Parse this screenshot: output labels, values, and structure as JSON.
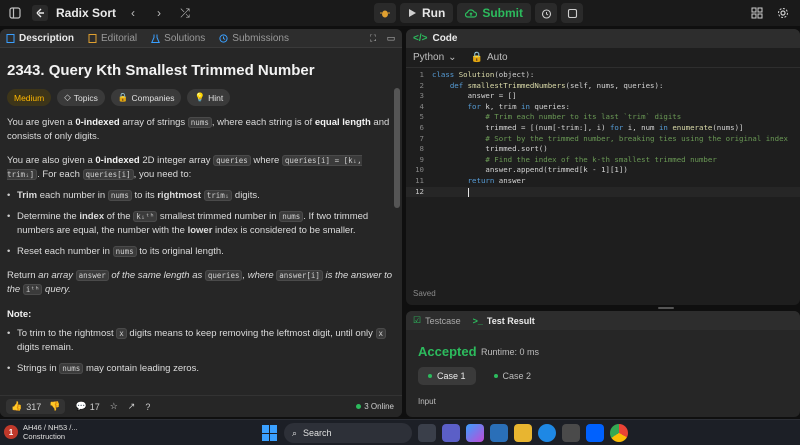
{
  "topbar": {
    "title": "Radix Sort",
    "run_label": "Run",
    "submit_label": "Submit"
  },
  "left": {
    "tabs": [
      {
        "label": "Description"
      },
      {
        "label": "Editorial"
      },
      {
        "label": "Solutions"
      },
      {
        "label": "Submissions"
      }
    ],
    "problem_title": "2343. Query Kth Smallest Trimmed Number",
    "tags": [
      {
        "label": "Medium"
      },
      {
        "label": "Topics"
      },
      {
        "label": "Companies"
      },
      {
        "label": "Hint"
      }
    ],
    "p1": {
      "a": "You are given a ",
      "b": "0-indexed",
      "c": " array of strings ",
      "code1": "nums",
      "d": ", where each string is of ",
      "e": "equal length",
      "f": " and consists of only digits."
    },
    "p2": {
      "a": "You are also given a ",
      "b": "0-indexed",
      "c": " 2D integer array ",
      "code1": "queries",
      "d": " where ",
      "code2": "queries[i] = [kᵢ, trimᵢ]",
      "e": ". For each ",
      "code3": "queries[i]",
      "f": ", you need to:"
    },
    "bullets": {
      "b1": {
        "a": "Trim",
        "b": " each number in ",
        "code1": "nums",
        "c": " to its ",
        "d": "rightmost",
        "code2": "trimᵢ",
        "e": " digits."
      },
      "b2": {
        "a": "Determine the ",
        "b": "index",
        "c": " of the ",
        "code1": "kᵢᵗʰ",
        "d": " smallest trimmed number in ",
        "code2": "nums",
        "e": ". If two trimmed numbers are equal, the number with the ",
        "f": "lower",
        "g": " index is considered to be smaller."
      },
      "b3": {
        "a": "Reset each number in ",
        "code1": "nums",
        "b": " to its original length."
      }
    },
    "p3": {
      "a": "Return ",
      "b": "an array ",
      "code1": "answer",
      "c": " of the same length as ",
      "code2": "queries",
      "d": ", where ",
      "code3": "answer[i]",
      "e": " is the answer to the ",
      "code4": "iᵗʰ",
      "f": " query."
    },
    "note_label": "Note:",
    "notes": {
      "n1": {
        "a": "To trim to the rightmost ",
        "code1": "x",
        "b": " digits means to keep removing the leftmost digit, until only ",
        "code2": "x",
        "c": " digits remain."
      },
      "n2": {
        "a": "Strings in ",
        "code1": "nums",
        "b": " may contain leading zeros."
      }
    },
    "bottom": {
      "likes": "317",
      "comments": "17",
      "online": "3 Online"
    }
  },
  "code_panel": {
    "title": "Code",
    "language": "Python",
    "mode": "Auto",
    "saved": "Saved",
    "lines": [
      {
        "n": "1",
        "text": "class Solution(object):"
      },
      {
        "n": "2",
        "text": "    def smallestTrimmedNumbers(self, nums, queries):"
      },
      {
        "n": "3",
        "text": "        answer = []"
      },
      {
        "n": "4",
        "text": "        for k, trim in queries:"
      },
      {
        "n": "5",
        "text": "            # Trim each number to its last `trim` digits"
      },
      {
        "n": "6",
        "text": "            trimmed = [(num[-trim:], i) for i, num in enumerate(nums)]"
      },
      {
        "n": "7",
        "text": "            # Sort by the trimmed number, breaking ties using the original index"
      },
      {
        "n": "8",
        "text": "            trimmed.sort()"
      },
      {
        "n": "9",
        "text": "            # Find the index of the k-th smallest trimmed number"
      },
      {
        "n": "10",
        "text": "            answer.append(trimmed[k - 1][1])"
      },
      {
        "n": "11",
        "text": "        return answer"
      },
      {
        "n": "12",
        "text": "        "
      }
    ]
  },
  "test_panel": {
    "tab_testcase": "Testcase",
    "tab_result": "Test Result",
    "status": "Accepted",
    "runtime": "Runtime: 0 ms",
    "cases": [
      {
        "label": "Case 1"
      },
      {
        "label": "Case 2"
      }
    ],
    "input_label": "Input"
  },
  "taskbar": {
    "notice_badge": "1",
    "notice_line1": "AH46 / NH53 /...",
    "notice_line2": "Construction",
    "search_placeholder": "Search"
  },
  "colors": {
    "accent_green": "#2cbb5d",
    "medium": "#ffb800",
    "keyword": "#569cd6",
    "function": "#dcdcaa",
    "comment": "#6a9955"
  }
}
